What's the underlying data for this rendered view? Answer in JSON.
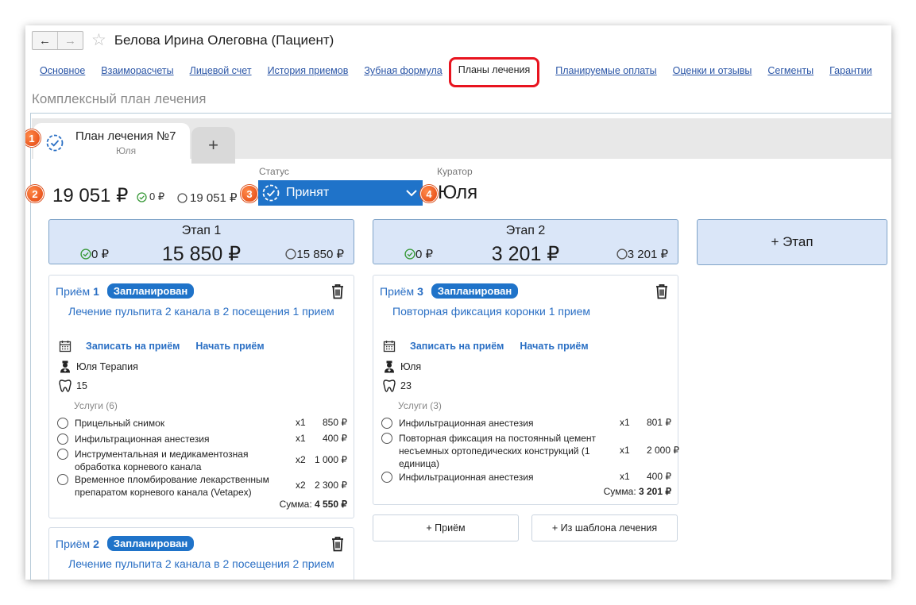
{
  "window": {
    "title": "Белова Ирина Олеговна (Пациент)",
    "back": "←",
    "forward": "→",
    "star": "☆"
  },
  "tabs": [
    {
      "label": "Основное",
      "active": false
    },
    {
      "label": "Взаиморасчеты",
      "active": false
    },
    {
      "label": "Лицевой счет",
      "active": false
    },
    {
      "label": "История приемов",
      "active": false
    },
    {
      "label": "Зубная формула",
      "active": false
    },
    {
      "label": "Планы лечения",
      "active": true
    },
    {
      "label": "Планируемые оплаты",
      "active": false
    },
    {
      "label": "Оценки и отзывы",
      "active": false
    },
    {
      "label": "Сегменты",
      "active": false
    },
    {
      "label": "Гарантии",
      "active": false
    }
  ],
  "subtitle": "Комплексный план лечения",
  "plan": {
    "tab_title": "План лечения №7",
    "tab_sub": "Юля",
    "add_tab": "+",
    "total": "19 051 ₽",
    "paid": "0 ₽",
    "remaining": "19 051 ₽",
    "status_label": "Статус",
    "status_value": "Принят",
    "curator_label": "Куратор",
    "curator_value": "Юля"
  },
  "badges": [
    "1",
    "2",
    "3",
    "4"
  ],
  "stages": [
    {
      "title": "Этап 1",
      "paid": "0 ₽",
      "sum": "15 850 ₽",
      "remaining": "15 850 ₽"
    },
    {
      "title": "Этап 2",
      "paid": "0 ₽",
      "sum": "3 201 ₽",
      "remaining": "3 201 ₽"
    }
  ],
  "add_stage": "+ Этап",
  "visits": [
    {
      "prefix": "Приём",
      "num": "1",
      "status": "Запланирован",
      "treatment": "Лечение пульпита 2 канала в 2 посещения 1 прием",
      "book": "Записать на приём",
      "start": "Начать приём",
      "doctor": "Юля Терапия",
      "tooth": "15",
      "services_header": "Услуги (6)",
      "services": [
        {
          "name": "Прицельный снимок",
          "qty": "x1",
          "price": "850 ₽"
        },
        {
          "name": "Инфильтрационная анестезия",
          "qty": "x1",
          "price": "400 ₽"
        },
        {
          "name": "Инструментальная и медикаментозная обработка корневого канала",
          "qty": "x2",
          "price": "1 000 ₽"
        },
        {
          "name": "Временное пломбирование лекарственным препаратом корневого канала (Vetapex)",
          "qty": "x2",
          "price": "2 300 ₽"
        }
      ],
      "total_label": "Сумма:",
      "total_value": "4 550 ₽"
    },
    {
      "prefix": "Приём",
      "num": "3",
      "status": "Запланирован",
      "treatment": "Повторная фиксация коронки 1 прием",
      "book": "Записать на приём",
      "start": "Начать приём",
      "doctor": "Юля",
      "tooth": "23",
      "services_header": "Услуги (3)",
      "services": [
        {
          "name": "Инфильтрационная анестезия",
          "qty": "x1",
          "price": "801 ₽"
        },
        {
          "name": "Повторная фиксация на постоянный цемент несъемных ортопедических конструкций (1 единица)",
          "qty": "x1",
          "price": "2 000 ₽"
        },
        {
          "name": "Инфильтрационная анестезия",
          "qty": "x1",
          "price": "400 ₽"
        }
      ],
      "total_label": "Сумма:",
      "total_value": "3 201 ₽"
    },
    {
      "prefix": "Приём",
      "num": "2",
      "status": "Запланирован",
      "treatment": "Лечение пульпита 2 канала в 2 посещения 2 прием"
    }
  ],
  "buttons": {
    "add_visit": "+ Приём",
    "from_template": "+ Из шаблона лечения"
  },
  "colors": {
    "accent": "#1f73c9",
    "link": "#2a6fc4",
    "stage_bg": "#dae6f8",
    "highlight": "#e8141f",
    "badge": "#e2430e"
  }
}
